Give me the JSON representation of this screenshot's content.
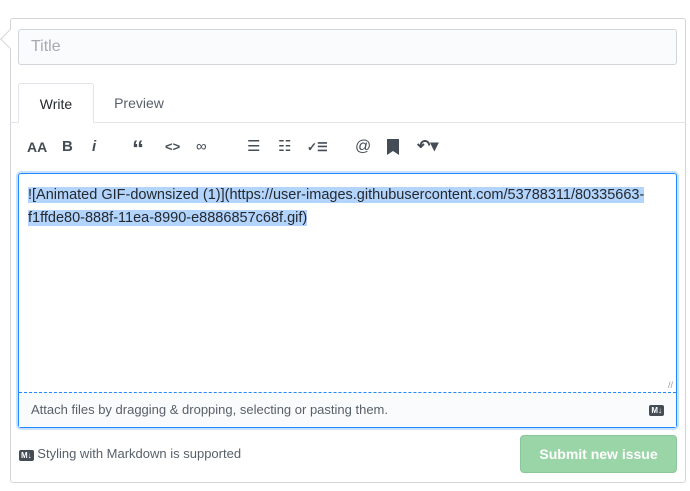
{
  "title_input": {
    "placeholder": "Title",
    "value": ""
  },
  "tabs": [
    {
      "label": "Write",
      "active": true
    },
    {
      "label": "Preview",
      "active": false
    }
  ],
  "toolbar": [
    "text-size-icon",
    "bold-icon",
    "italic-icon",
    "quote-icon",
    "code-icon",
    "link-icon",
    "bullet-list-icon",
    "numbered-list-icon",
    "task-list-icon",
    "mention-icon",
    "saved-reply-icon",
    "reply-icon"
  ],
  "toolbar_glyphs": {
    "heading": "AA",
    "bold": "B",
    "italic": "i",
    "quote": "“",
    "code": "<>",
    "link": "∞",
    "ul": "☰",
    "ol": "☷",
    "task": "✓☰",
    "mention": "@",
    "saved": "🔖",
    "reply": "↶▾"
  },
  "editor": {
    "value": "![Animated GIF-downsized (1)](https://user-images.githubusercontent.com/53788311/80335663-f1ffde80-888f-11ea-8990-e8886857c68f.gif)",
    "attach_hint": "Attach files by dragging & dropping, selecting or pasting them.",
    "md_badge": "M↓"
  },
  "markdown_hint": "Styling with Markdown is supported",
  "submit_label": "Submit new issue",
  "colors": {
    "accent": "#2188ff",
    "submit": "#94d3a2"
  }
}
